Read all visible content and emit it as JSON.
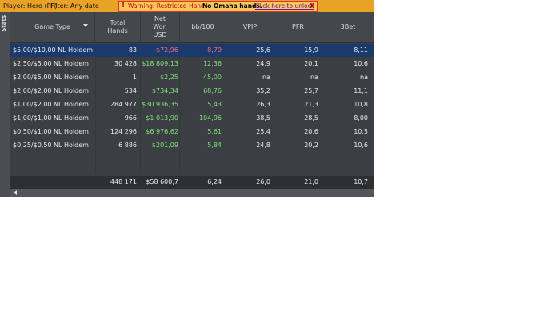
{
  "topbar": {
    "player": "Player: Hero (PP)",
    "filter": "Filter: Any date",
    "warning_mark": "!",
    "warning": "Warning: Restricted Hands",
    "no_omaha": "No Omaha hands.",
    "unlock_link": "Click here to unlock",
    "close": "X"
  },
  "sidebar": {
    "label": "Stats"
  },
  "columns": [
    {
      "label": "Game Type"
    },
    {
      "label": "Total Hands"
    },
    {
      "label": "Net Won USD"
    },
    {
      "label": "bb/100"
    },
    {
      "label": "VPIP"
    },
    {
      "label": "PFR"
    },
    {
      "label": "3Bet"
    }
  ],
  "rows": [
    {
      "game": "$5,00/$10,00 NL Holdem",
      "hands": "83",
      "net": "-$72,96",
      "bb100": "-8,79",
      "vpip": "25,6",
      "pfr": "15,9",
      "threebet": "8,11"
    },
    {
      "game": "$2,50/$5,00 NL Holdem",
      "hands": "30 428",
      "net": "$18 809,13",
      "bb100": "12,36",
      "vpip": "24,9",
      "pfr": "20,1",
      "threebet": "10,6"
    },
    {
      "game": "$2,00/$5,00 NL Holdem",
      "hands": "1",
      "net": "$2,25",
      "bb100": "45,00",
      "vpip": "na",
      "pfr": "na",
      "threebet": "na"
    },
    {
      "game": "$2,00/$2,00 NL Holdem",
      "hands": "534",
      "net": "$734,34",
      "bb100": "68,76",
      "vpip": "35,2",
      "pfr": "25,7",
      "threebet": "11,1"
    },
    {
      "game": "$1,00/$2,00 NL Holdem",
      "hands": "284 977",
      "net": "$30 936,35",
      "bb100": "5,43",
      "vpip": "26,3",
      "pfr": "21,3",
      "threebet": "10,8"
    },
    {
      "game": "$1,00/$1,00 NL Holdem",
      "hands": "966",
      "net": "$1 013,90",
      "bb100": "104,96",
      "vpip": "38,5",
      "pfr": "28,5",
      "threebet": "8,00"
    },
    {
      "game": "$0,50/$1,00 NL Holdem",
      "hands": "124 296",
      "net": "$6 976,62",
      "bb100": "5,61",
      "vpip": "25,4",
      "pfr": "20,6",
      "threebet": "10,5"
    },
    {
      "game": "$0,25/$0,50 NL Holdem",
      "hands": "6 886",
      "net": "$201,09",
      "bb100": "5,84",
      "vpip": "24,8",
      "pfr": "20,2",
      "threebet": "10,6"
    }
  ],
  "totals": {
    "hands": "448 171",
    "net": "$58 600,7",
    "bb100": "6,24",
    "vpip": "26,0",
    "pfr": "21,0",
    "threebet": "10,7"
  },
  "colors": {
    "positive": "#7fe07a",
    "negative": "#ff6a6a",
    "selected_row": "#1b3a6b",
    "topbar": "#e8a226"
  }
}
